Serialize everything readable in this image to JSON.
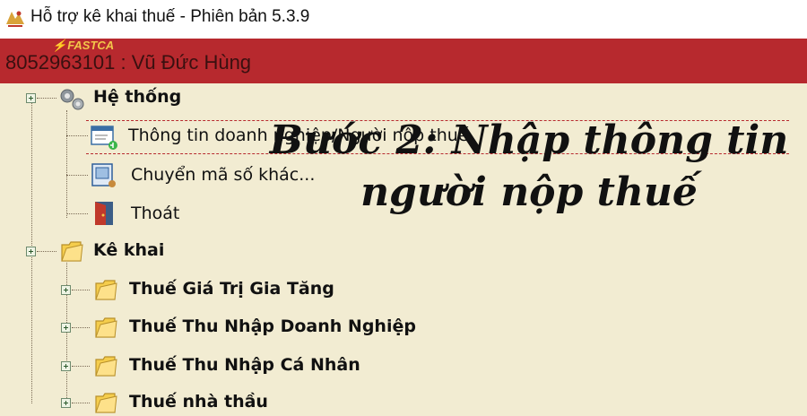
{
  "window": {
    "title": "Hỗ trợ kê khai thuế -  Phiên bản 5.3.9"
  },
  "header": {
    "brand": "FASTCA",
    "user_line": "8052963101 : Vũ Đức Hùng"
  },
  "tree": {
    "nodes": [
      {
        "label": "Hệ thống",
        "icon": "gears-icon",
        "bold": true,
        "expandable": true
      },
      {
        "label": "Thông tin doanh nghiệp/Người nộp thuế",
        "icon": "company-info-icon",
        "bold": false,
        "selected": true
      },
      {
        "label": "Chuyển mã số khác...",
        "icon": "switch-code-icon",
        "bold": false
      },
      {
        "label": "Thoát",
        "icon": "exit-door-icon",
        "bold": false
      },
      {
        "label": "Kê khai",
        "icon": "folder-icon",
        "bold": true,
        "expandable": true
      },
      {
        "label": "Thuế Giá Trị Gia Tăng",
        "icon": "folder-icon",
        "bold": true,
        "expandable": true
      },
      {
        "label": "Thuế Thu Nhập Doanh Nghiệp",
        "icon": "folder-icon",
        "bold": true,
        "expandable": true
      },
      {
        "label": "Thuế Thu Nhập Cá Nhân",
        "icon": "folder-icon",
        "bold": true,
        "expandable": true
      },
      {
        "label": "Thuế nhà thầu",
        "icon": "folder-icon",
        "bold": true,
        "expandable": true
      }
    ]
  },
  "caption": {
    "line1": "Bước 2: Nhập thông tin",
    "line2": "người nộp thuế"
  },
  "colors": {
    "header_bg": "#b7292e",
    "tree_bg": "#f2ecd2",
    "brand": "#f2c64a"
  }
}
